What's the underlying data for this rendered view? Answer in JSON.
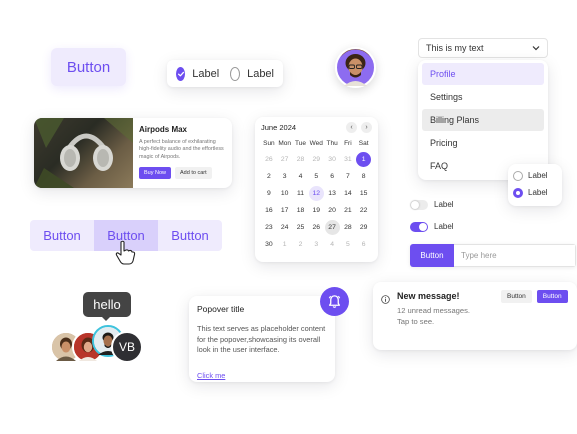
{
  "big_button": {
    "label": "Button"
  },
  "checkbox_pill": {
    "checkbox_label": "Label",
    "radio_label": "Label"
  },
  "dropdown": {
    "selected": "This is my text",
    "items": [
      {
        "label": "Profile",
        "state": "active"
      },
      {
        "label": "Settings",
        "state": "normal"
      },
      {
        "label": "Billing Plans",
        "state": "hover"
      },
      {
        "label": "Pricing",
        "state": "normal"
      },
      {
        "label": "FAQ",
        "state": "normal"
      }
    ]
  },
  "radio_card": {
    "options": [
      "Label",
      "Label"
    ],
    "selected_index": 1
  },
  "product": {
    "title": "Airpods Max",
    "description": "A perfect balance of exhilarating high-fidelity audio and the effortless magic of Airpods.",
    "buy_label": "Buy Now",
    "cart_label": "Add to cart"
  },
  "calendar": {
    "month_label": "June 2024",
    "prev_icon": "chevron-left-icon",
    "next_icon": "chevron-right-icon",
    "weekdays": [
      "Sun",
      "Mon",
      "Tue",
      "Wed",
      "Thu",
      "Fri",
      "Sat"
    ],
    "weeks": [
      [
        {
          "d": "26",
          "m": 1
        },
        {
          "d": "27",
          "m": 1
        },
        {
          "d": "28",
          "m": 1
        },
        {
          "d": "29",
          "m": 1
        },
        {
          "d": "30",
          "m": 1
        },
        {
          "d": "31",
          "m": 1
        },
        {
          "d": "1",
          "s": "sel"
        }
      ],
      [
        {
          "d": "2"
        },
        {
          "d": "3"
        },
        {
          "d": "4"
        },
        {
          "d": "5"
        },
        {
          "d": "6"
        },
        {
          "d": "7"
        },
        {
          "d": "8"
        }
      ],
      [
        {
          "d": "9"
        },
        {
          "d": "10"
        },
        {
          "d": "11"
        },
        {
          "d": "12",
          "s": "hl"
        },
        {
          "d": "13"
        },
        {
          "d": "14"
        },
        {
          "d": "15"
        }
      ],
      [
        {
          "d": "16"
        },
        {
          "d": "17"
        },
        {
          "d": "18"
        },
        {
          "d": "19"
        },
        {
          "d": "20"
        },
        {
          "d": "21"
        },
        {
          "d": "22"
        }
      ],
      [
        {
          "d": "23"
        },
        {
          "d": "24"
        },
        {
          "d": "25"
        },
        {
          "d": "26"
        },
        {
          "d": "27",
          "s": "today"
        },
        {
          "d": "28"
        },
        {
          "d": "29"
        }
      ],
      [
        {
          "d": "30"
        },
        {
          "d": "1",
          "m": 1
        },
        {
          "d": "2",
          "m": 1
        },
        {
          "d": "3",
          "m": 1
        },
        {
          "d": "4",
          "m": 1
        },
        {
          "d": "5",
          "m": 1
        },
        {
          "d": "6",
          "m": 1
        }
      ]
    ]
  },
  "toggles": [
    {
      "label": "Label",
      "on": false
    },
    {
      "label": "Label",
      "on": true
    }
  ],
  "input_group": {
    "button_label": "Button",
    "placeholder": "Type here"
  },
  "segmented": {
    "labels": [
      "Button",
      "Button",
      "Button"
    ],
    "active_index": 1
  },
  "tooltip": {
    "text": "hello"
  },
  "avatar_group": {
    "overflow_initials": "VB"
  },
  "popover": {
    "title": "Popover title",
    "body": "This text serves as placeholder content for the popover,showcasing its overall look in the user interface.",
    "link": "Click me"
  },
  "notification": {
    "title": "New message!",
    "body": "12 unread messages. Tap to see.",
    "close_icon": "close-icon",
    "btn_secondary": "Button",
    "btn_primary": "Button"
  },
  "colors": {
    "accent": "#6d4ef0",
    "accent_light": "#efebfd"
  }
}
